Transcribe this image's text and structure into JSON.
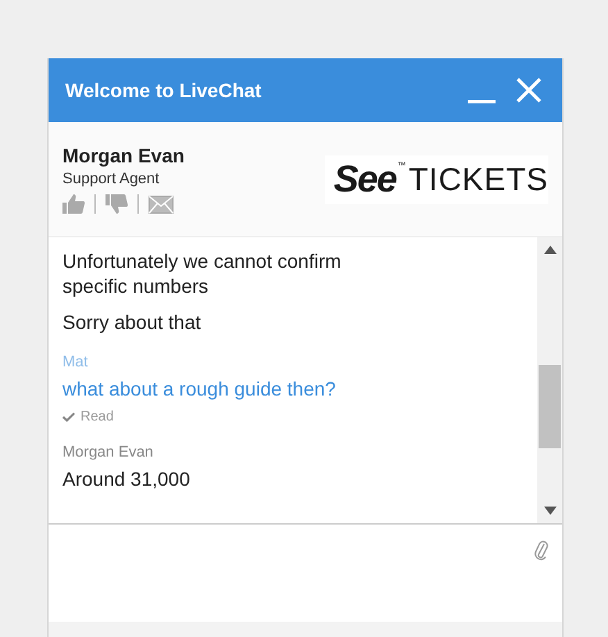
{
  "window": {
    "title": "Welcome to LiveChat"
  },
  "agent": {
    "name": "Morgan Evan",
    "role": "Support Agent"
  },
  "logo": {
    "brand": "See",
    "mark": "™",
    "name": "TICKETS"
  },
  "messages": [
    {
      "kind": "agent",
      "lines": [
        "Unfortunately we cannot confirm specific numbers",
        "Sorry about that"
      ]
    },
    {
      "kind": "visitor",
      "author": "Mat",
      "lines": [
        "what about a rough guide then?"
      ],
      "status": "Read"
    },
    {
      "kind": "agent",
      "author": "Morgan Evan",
      "lines": [
        "Around 31,000"
      ]
    }
  ]
}
